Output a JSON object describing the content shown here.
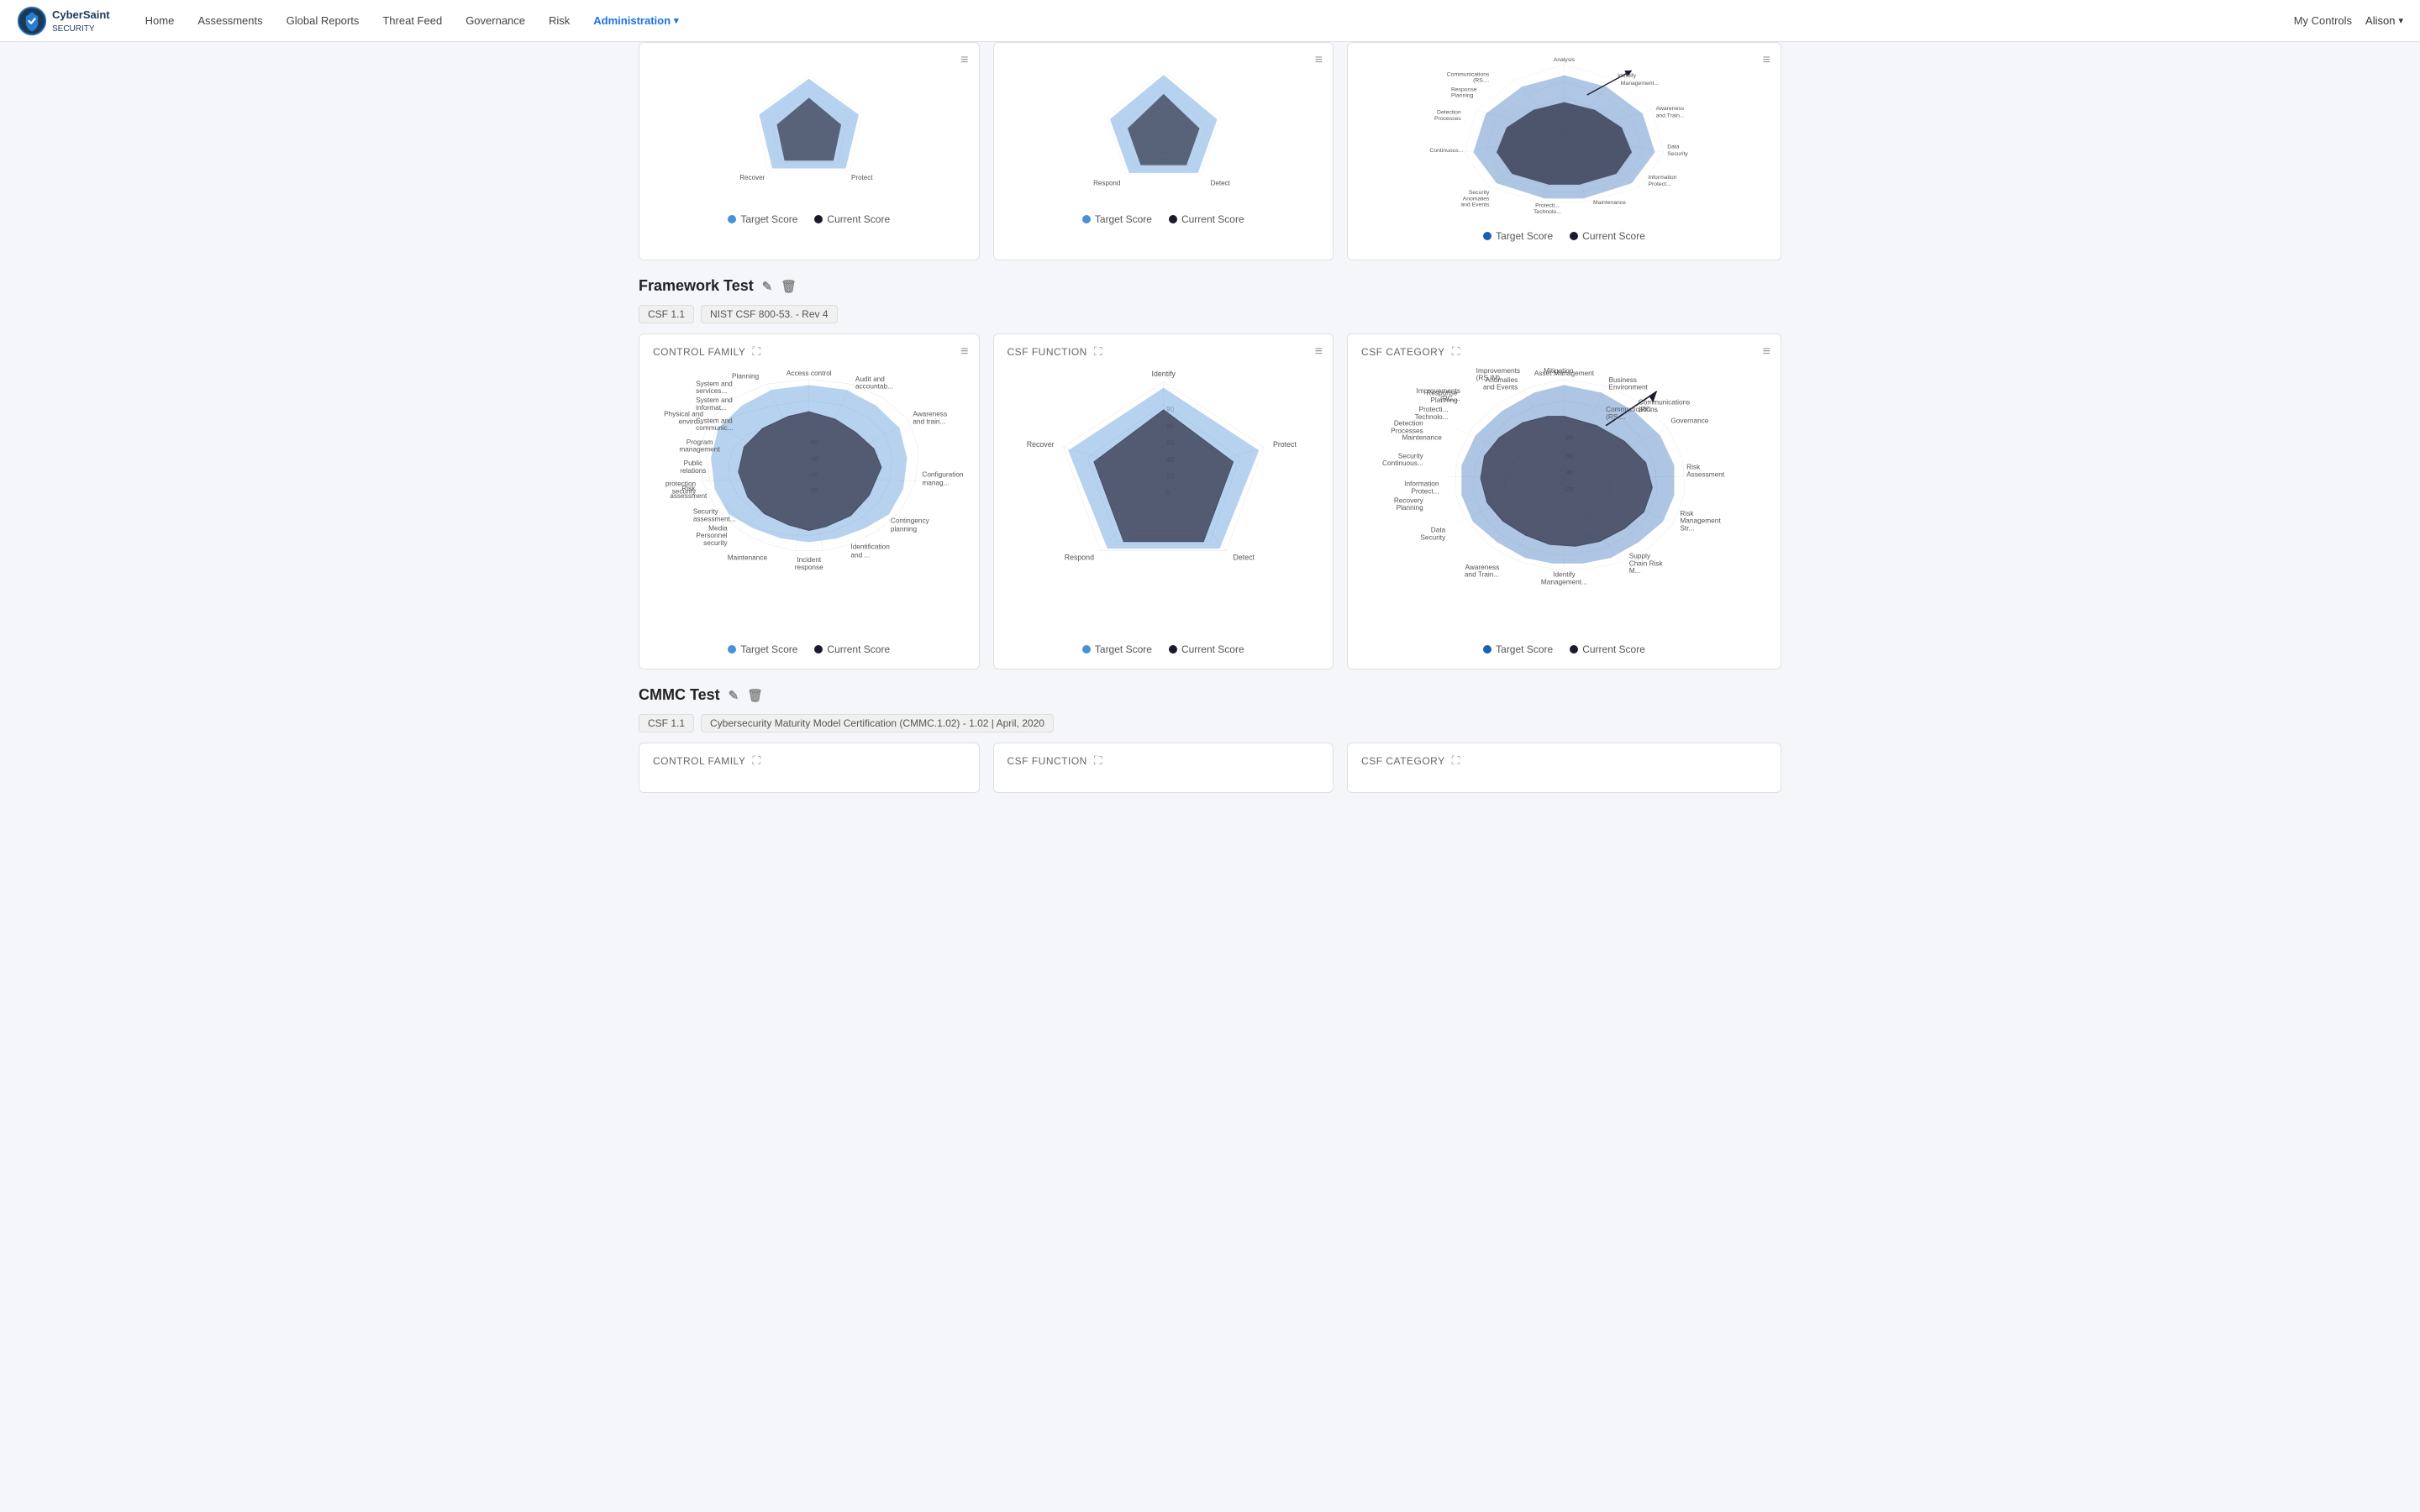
{
  "navbar": {
    "logo_alt": "CyberSaint Security",
    "links": [
      {
        "label": "Home",
        "active": false
      },
      {
        "label": "Assessments",
        "active": false
      },
      {
        "label": "Global Reports",
        "active": false
      },
      {
        "label": "Threat Feed",
        "active": false
      },
      {
        "label": "Governance",
        "active": false
      },
      {
        "label": "Risk",
        "active": false
      },
      {
        "label": "Administration",
        "active": true,
        "dropdown": true
      }
    ],
    "right_links": [
      "My Controls"
    ],
    "user": "Alison"
  },
  "top_partial_charts": [
    {
      "id": "top-control-family",
      "legend": [
        {
          "label": "Target Score",
          "color": "#4a90d9"
        },
        {
          "label": "Current Score",
          "color": "#1a1a2e"
        }
      ],
      "labels_bottom": [
        "Recover",
        "Protect"
      ]
    },
    {
      "id": "top-csf-function",
      "legend": [
        {
          "label": "Target Score",
          "color": "#4a90d9"
        },
        {
          "label": "Current Score",
          "color": "#1a1a2e"
        }
      ],
      "labels_bottom": [
        "Respond",
        "Detect"
      ]
    },
    {
      "id": "top-csf-category",
      "labels": [
        "Analysis",
        "Communications (RS....",
        "Response Planning",
        "Detection Processes",
        "Security Anomalies and Events",
        "Continuous...",
        "Protecti... Technolo...",
        "Maintenance",
        "Information Protect...",
        "Data Security",
        "Awareness and Train...",
        "Identify Management..."
      ],
      "legend": [
        {
          "label": "Target Score",
          "color": "#1a5fb4"
        },
        {
          "label": "Current Score",
          "color": "#1a1a2e"
        }
      ]
    }
  ],
  "framework_test": {
    "title": "Framework Test",
    "tags": [
      "CSF 1.1",
      "NIST CSF 800-53. - Rev 4"
    ],
    "sections": [
      {
        "id": "control-family",
        "header": "CONTROL FAMILY",
        "has_expand": true,
        "has_menu": true,
        "labels": [
          "System and services...",
          "System and informat...",
          "System and communic...",
          "Security assessment...",
          "Risk assessment",
          "Public relations",
          "Program management",
          "Planning",
          "Physical and enviro...",
          "Media Personnel security",
          "protection security",
          "Maintenance",
          "Incident response",
          "Identification and ...",
          "Contingency planning",
          "Configuration manag...",
          "Awareness and train...",
          "Audit and accountab...",
          "Access control"
        ],
        "radial_values": [
          20,
          40,
          60,
          80
        ],
        "legend": [
          {
            "label": "Target Score",
            "color": "#4a90d9"
          },
          {
            "label": "Current Score",
            "color": "#1a1a2e"
          }
        ]
      },
      {
        "id": "csf-function",
        "header": "CSF FUNCTION",
        "has_expand": true,
        "has_menu": true,
        "labels": [
          "Identify",
          "Protect",
          "Detect",
          "Respond",
          "Recover"
        ],
        "radial_values": [
          0,
          20,
          40,
          60,
          80,
          90
        ],
        "legend": [
          {
            "label": "Target Score",
            "color": "#4a90d9"
          },
          {
            "label": "Current Score",
            "color": "#1a1a2e"
          }
        ]
      },
      {
        "id": "csf-category",
        "header": "CSF CATEGORY",
        "has_expand": true,
        "has_menu": true,
        "labels": [
          "Asset Management",
          "Business Environment",
          "Governance",
          "Risk Assessment",
          "Risk Management Str...",
          "Supply Chain Risk M...",
          "Identify Management...",
          "Awareness and Train...",
          "Data Security",
          "Information Protect...",
          "Maintenance",
          "Protective Technolo...",
          "Anomalies and Events",
          "Security Continuous...",
          "Detection Processes",
          "Response Planning",
          "Communications (RS....",
          "Mitigation",
          "Improvements (RS.IM)",
          "Recovery Planning",
          "Improvements (RC....",
          "Communications (RC...."
        ],
        "legend": [
          {
            "label": "Target Score",
            "color": "#1a5fb4"
          },
          {
            "label": "Current Score",
            "color": "#1a1a2e"
          }
        ]
      }
    ]
  },
  "cmmc_test": {
    "title": "CMMC Test",
    "tags": [
      "CSF 1.1",
      "Cybersecurity Maturity Model Certification (CMMC.1.02) - 1.02 | April, 2020"
    ],
    "sections": [
      {
        "id": "control-family-cmmc",
        "header": "CONTROL FAMILY",
        "has_expand": true
      },
      {
        "id": "csf-function-cmmc",
        "header": "CSF FUNCTION",
        "has_expand": true
      },
      {
        "id": "csf-category-cmmc",
        "header": "CSF CATEGORY",
        "has_expand": true
      }
    ]
  },
  "icons": {
    "edit": "✎",
    "delete": "🗑",
    "menu": "≡",
    "expand": "⛶",
    "chevron_down": "▾"
  }
}
